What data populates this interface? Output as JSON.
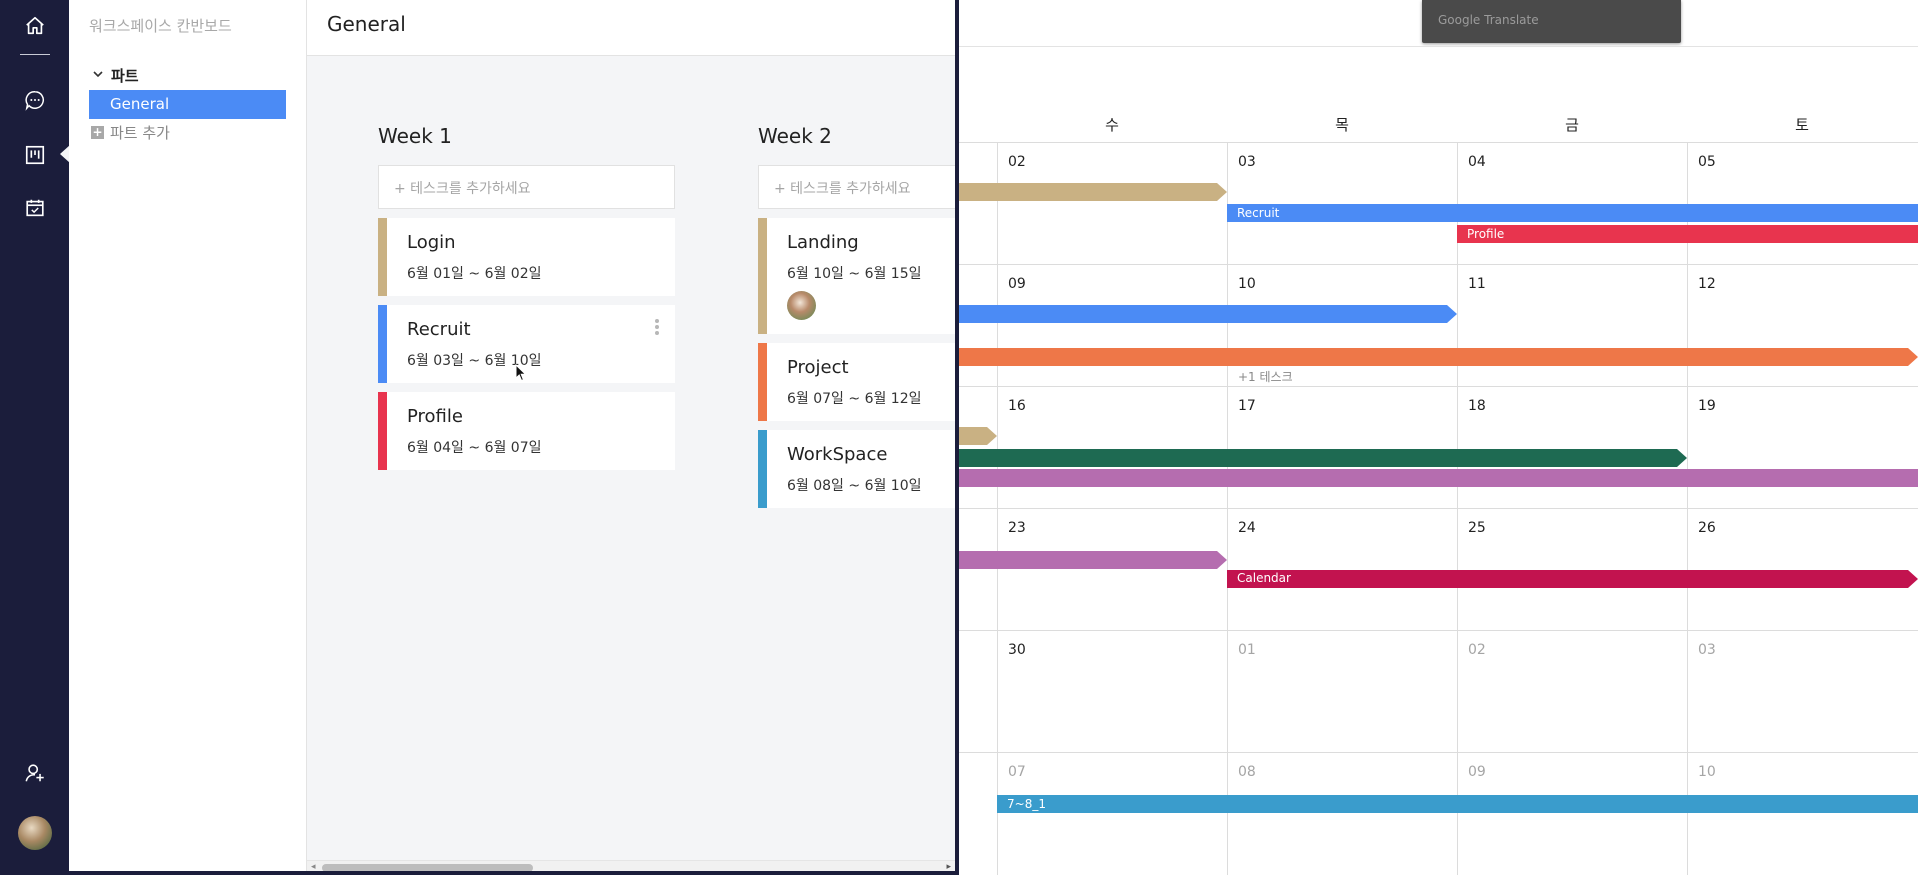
{
  "sidebar": {
    "workspace_title": "워크스페이스 칸반보드",
    "group_label": "파트",
    "active_item": "General",
    "add_label": "파트 추가"
  },
  "board": {
    "title": "General",
    "columns": [
      {
        "title": "Week 1",
        "add_placeholder": "+ 테스크를 추가하세요",
        "cards": [
          {
            "title": "Login",
            "dates": "6월 01일 ~ 6월 02일",
            "color": "#c9b183"
          },
          {
            "title": "Recruit",
            "dates": "6월 03일 ~ 6월 10일",
            "color": "#4b8bf5"
          },
          {
            "title": "Profile",
            "dates": "6월 04일 ~ 6월 07일",
            "color": "#e8344e"
          }
        ]
      },
      {
        "title": "Week 2",
        "add_placeholder": "+ 테스크를 추가하세요",
        "cards": [
          {
            "title": "Landing",
            "dates": "6월 10일 ~ 6월 15일",
            "color": "#c9b183"
          },
          {
            "title": "Project",
            "dates": "6월 07일 ~ 6월 12일",
            "color": "#ee7748"
          },
          {
            "title": "WorkSpace",
            "dates": "6월 08일 ~ 6월 10일",
            "color": "#3a9ccc"
          }
        ]
      }
    ]
  },
  "google_translate": "Google Translate",
  "calendar": {
    "weekdays": [
      "수",
      "목",
      "금",
      "토"
    ],
    "weeks": [
      [
        "02",
        "03",
        "04",
        "05"
      ],
      [
        "09",
        "10",
        "11",
        "12"
      ],
      [
        "16",
        "17",
        "18",
        "19"
      ],
      [
        "23",
        "24",
        "25",
        "26"
      ],
      [
        "30",
        "01",
        "02",
        "03"
      ],
      [
        "07",
        "08",
        "09",
        "10"
      ]
    ],
    "events": {
      "recruit": "Recruit",
      "profile": "Profile",
      "calendar": "Calendar",
      "seven_eight": "7~8_1"
    },
    "more_label": "+1 테스크"
  },
  "colors": {
    "rail": "#1b1d3b",
    "accent": "#4b8bf5",
    "tan": "#c9b183",
    "blue": "#4b8bf5",
    "red": "#e8344e",
    "orange": "#ee7748",
    "green": "#1e6a52",
    "purple": "#b56daf",
    "crimson": "#c2134f",
    "teal": "#3a9ccc"
  }
}
